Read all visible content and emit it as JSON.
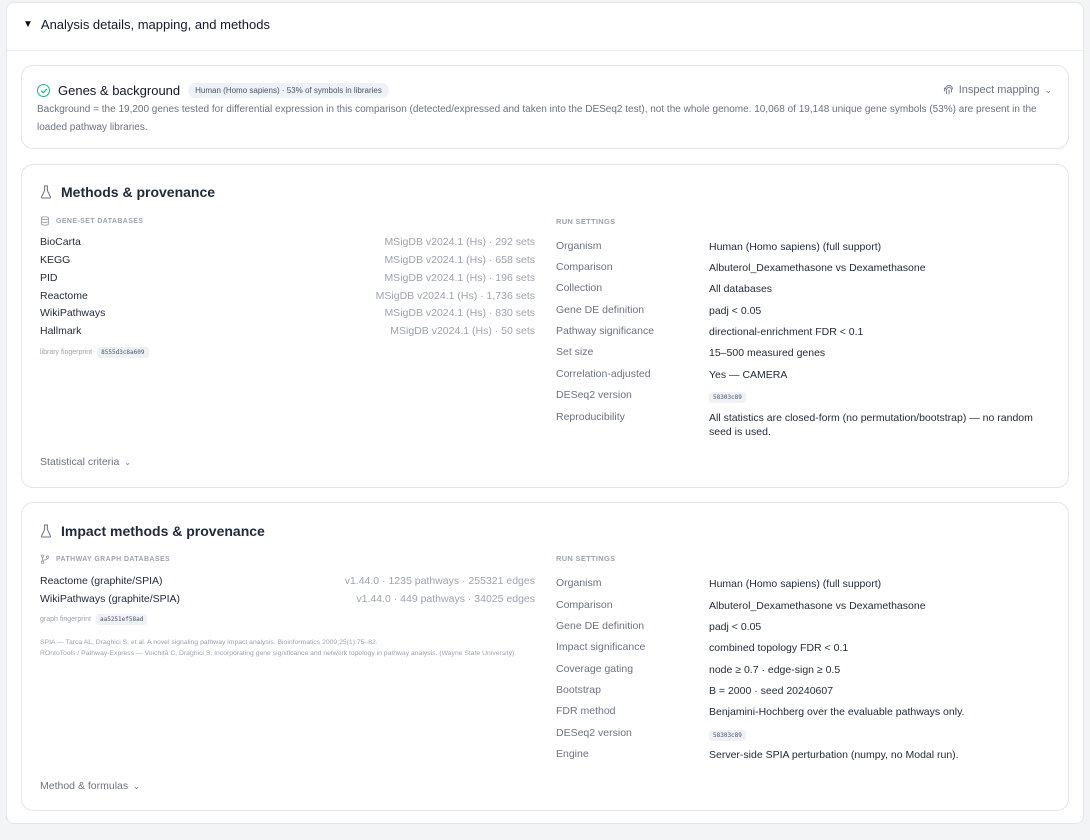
{
  "header": {
    "title": "Analysis details, mapping, and methods"
  },
  "genes": {
    "title": "Genes & background",
    "badge": "Human (Homo sapiens) · 53% of symbols in libraries",
    "inspect_label": "Inspect mapping",
    "background_text": "Background = the 19,200 genes tested for differential expression in this comparison (detected/expressed and taken into the DESeq2 test), not the whole genome. 10,068 of 19,148 unique gene symbols (53%) are present in the loaded pathway libraries."
  },
  "methods": {
    "title": "Methods & provenance",
    "db_label": "GENE-SET DATABASES",
    "databases": [
      {
        "name": "BioCarta",
        "version": "MSigDB v2024.1 (Hs) · 292 sets"
      },
      {
        "name": "KEGG",
        "version": "MSigDB v2024.1 (Hs) · 658 sets"
      },
      {
        "name": "PID",
        "version": "MSigDB v2024.1 (Hs) · 196 sets"
      },
      {
        "name": "Reactome",
        "version": "MSigDB v2024.1 (Hs) · 1,736 sets"
      },
      {
        "name": "WikiPathways",
        "version": "MSigDB v2024.1 (Hs) · 830 sets"
      },
      {
        "name": "Hallmark",
        "version": "MSigDB v2024.1 (Hs) · 50 sets"
      }
    ],
    "fingerprint_label": "library fingerprint",
    "fingerprint": "8555d3c8a609",
    "run_label": "RUN SETTINGS",
    "settings": [
      {
        "key": "Organism",
        "value": "Human (Homo sapiens) (full support)"
      },
      {
        "key": "Comparison",
        "value": "Albuterol_Dexamethasone vs Dexamethasone"
      },
      {
        "key": "Collection",
        "value": "All databases"
      },
      {
        "key": "Gene DE definition",
        "value": "padj < 0.05"
      },
      {
        "key": "Pathway significance",
        "value": "directional-enrichment FDR < 0.1"
      },
      {
        "key": "Set size",
        "value": "15–500 measured genes"
      },
      {
        "key": "Correlation-adjusted",
        "value": "Yes — CAMERA"
      },
      {
        "key": "DESeq2 version",
        "value": "58303c89"
      },
      {
        "key": "Reproducibility",
        "value": "All statistics are closed-form (no permutation/bootstrap) — no random seed is used."
      }
    ],
    "criteria_label": "Statistical criteria"
  },
  "impact": {
    "title": "Impact methods & provenance",
    "db_label": "PATHWAY GRAPH DATABASES",
    "databases": [
      {
        "name": "Reactome (graphite/SPIA)",
        "version": "v1.44.0 · 1235 pathways · 255321 edges"
      },
      {
        "name": "WikiPathways (graphite/SPIA)",
        "version": "v1.44.0 · 449 pathways · 34025 edges"
      }
    ],
    "fingerprint_label": "graph fingerprint",
    "fingerprint": "aa5251ef58ad",
    "refs": [
      "SPIA — Tarca AL, Draghici S, et al. A novel signaling pathway impact analysis. Bioinformatics 2009;25(1):75–82.",
      "ROntoTools / Pathway-Express — Voichiță C, Draghici S. Incorporating gene significance and network topology in pathway analysis. (Wayne State University)."
    ],
    "run_label": "RUN SETTINGS",
    "settings": [
      {
        "key": "Organism",
        "value": "Human (Homo sapiens) (full support)"
      },
      {
        "key": "Comparison",
        "value": "Albuterol_Dexamethasone vs Dexamethasone"
      },
      {
        "key": "Gene DE definition",
        "value": "padj < 0.05"
      },
      {
        "key": "Impact significance",
        "value": "combined topology FDR < 0.1"
      },
      {
        "key": "Coverage gating",
        "value": "node ≥ 0.7 · edge-sign ≥ 0.5"
      },
      {
        "key": "Bootstrap",
        "value": "B = 2000 · seed 20240607"
      },
      {
        "key": "FDR method",
        "value": "Benjamini-Hochberg over the evaluable pathways only."
      },
      {
        "key": "DESeq2 version",
        "value": "58303c89"
      },
      {
        "key": "Engine",
        "value": "Server-side SPIA perturbation (numpy, no Modal run)."
      }
    ],
    "formulas_label": "Method & formulas"
  }
}
